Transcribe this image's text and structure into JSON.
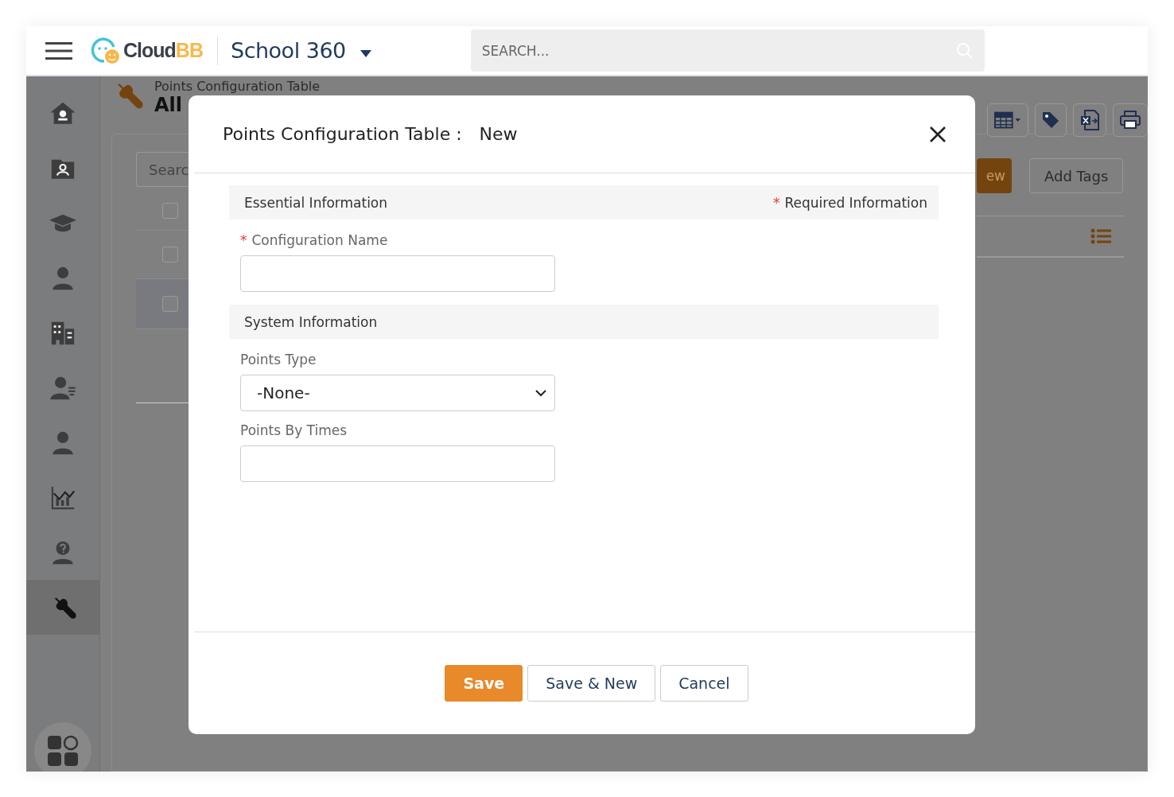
{
  "topbar": {
    "brand": "Cloud",
    "brand_accent": "BB",
    "app_name": "School 360",
    "search": {
      "placeholder": "SEARCH..."
    }
  },
  "sidebar": {
    "items": [
      {
        "selected": false
      },
      {
        "selected": false
      },
      {
        "selected": false
      },
      {
        "selected": false
      },
      {
        "selected": false
      },
      {
        "selected": false
      },
      {
        "selected": false
      },
      {
        "selected": false
      },
      {
        "selected": false
      },
      {
        "selected": true
      }
    ]
  },
  "page": {
    "breadcrumb": "Points Configuration Table",
    "view": "All",
    "search": {
      "placeholder": "Searc"
    },
    "new_button": "ew",
    "add_tags_button": "Add Tags",
    "rows": [
      {
        "checked": false
      },
      {
        "checked": false
      },
      {
        "checked": false
      }
    ]
  },
  "dialog": {
    "title": "Points Configuration Table :",
    "mode": "New",
    "sections": [
      {
        "title": "Essential Information",
        "note_mark": "*",
        "note": "Required Information",
        "fields": [
          {
            "kind": "text",
            "label": "Configuration Name",
            "mark": "*"
          }
        ]
      },
      {
        "title": "System Information",
        "fields": [
          {
            "kind": "select",
            "label": "Points Type",
            "value": "-None-"
          },
          {
            "kind": "text",
            "label": "Points By Times"
          }
        ]
      }
    ],
    "buttons": [
      {
        "label": "Save",
        "kind": "primary"
      },
      {
        "label": "Save & New",
        "kind": "default"
      },
      {
        "label": "Cancel",
        "kind": "default"
      }
    ]
  }
}
